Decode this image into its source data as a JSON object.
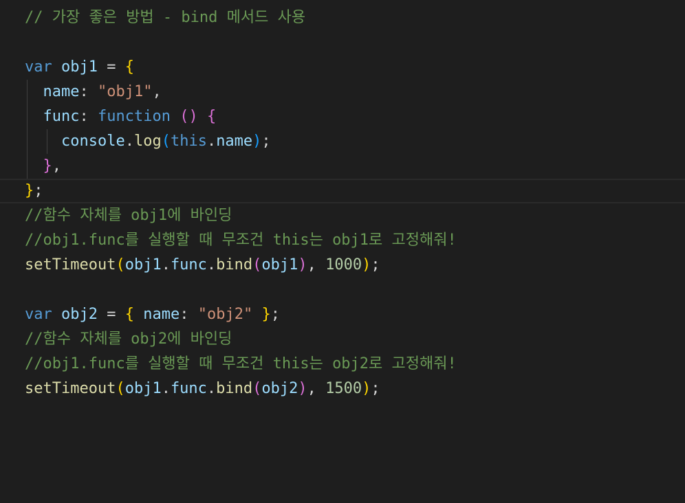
{
  "editor": {
    "lines": [
      {
        "tokens": [
          {
            "t": "// 가장 좋은 방법 - bind 메서드 사용",
            "c": "comment"
          }
        ]
      },
      {
        "tokens": []
      },
      {
        "tokens": [
          {
            "t": "var",
            "c": "keyword"
          },
          {
            "t": " ",
            "c": "punct"
          },
          {
            "t": "obj1",
            "c": "var"
          },
          {
            "t": " = ",
            "c": "punct"
          },
          {
            "t": "{",
            "c": "brace1"
          }
        ]
      },
      {
        "tokens": [
          {
            "t": "  ",
            "c": "punct"
          },
          {
            "t": "name",
            "c": "var"
          },
          {
            "t": ": ",
            "c": "punct"
          },
          {
            "t": "\"obj1\"",
            "c": "string"
          },
          {
            "t": ",",
            "c": "punct"
          }
        ]
      },
      {
        "tokens": [
          {
            "t": "  ",
            "c": "punct"
          },
          {
            "t": "func",
            "c": "var"
          },
          {
            "t": ": ",
            "c": "punct"
          },
          {
            "t": "function",
            "c": "keyword"
          },
          {
            "t": " ",
            "c": "punct"
          },
          {
            "t": "()",
            "c": "brace2"
          },
          {
            "t": " ",
            "c": "punct"
          },
          {
            "t": "{",
            "c": "brace2"
          }
        ]
      },
      {
        "tokens": [
          {
            "t": "    ",
            "c": "punct"
          },
          {
            "t": "console",
            "c": "var"
          },
          {
            "t": ".",
            "c": "punct"
          },
          {
            "t": "log",
            "c": "func"
          },
          {
            "t": "(",
            "c": "brace3"
          },
          {
            "t": "this",
            "c": "keyword"
          },
          {
            "t": ".",
            "c": "punct"
          },
          {
            "t": "name",
            "c": "var"
          },
          {
            "t": ")",
            "c": "brace3"
          },
          {
            "t": ";",
            "c": "punct"
          }
        ]
      },
      {
        "tokens": [
          {
            "t": "  ",
            "c": "punct"
          },
          {
            "t": "}",
            "c": "brace2"
          },
          {
            "t": ",",
            "c": "punct"
          }
        ]
      },
      {
        "tokens": [
          {
            "t": "}",
            "c": "brace1"
          },
          {
            "t": ";",
            "c": "punct"
          }
        ],
        "current": true
      },
      {
        "tokens": [
          {
            "t": "//함수 자체를 obj1에 바인딩",
            "c": "comment"
          }
        ]
      },
      {
        "tokens": [
          {
            "t": "//obj1.func를 실행할 때 무조건 this는 obj1로 고정해줘!",
            "c": "comment"
          }
        ]
      },
      {
        "tokens": [
          {
            "t": "setTimeout",
            "c": "func"
          },
          {
            "t": "(",
            "c": "brace1"
          },
          {
            "t": "obj1",
            "c": "var"
          },
          {
            "t": ".",
            "c": "punct"
          },
          {
            "t": "func",
            "c": "var"
          },
          {
            "t": ".",
            "c": "punct"
          },
          {
            "t": "bind",
            "c": "func"
          },
          {
            "t": "(",
            "c": "brace2"
          },
          {
            "t": "obj1",
            "c": "var"
          },
          {
            "t": ")",
            "c": "brace2"
          },
          {
            "t": ", ",
            "c": "punct"
          },
          {
            "t": "1000",
            "c": "number"
          },
          {
            "t": ")",
            "c": "brace1"
          },
          {
            "t": ";",
            "c": "punct"
          }
        ]
      },
      {
        "tokens": []
      },
      {
        "tokens": [
          {
            "t": "var",
            "c": "keyword"
          },
          {
            "t": " ",
            "c": "punct"
          },
          {
            "t": "obj2",
            "c": "var"
          },
          {
            "t": " = ",
            "c": "punct"
          },
          {
            "t": "{",
            "c": "brace1"
          },
          {
            "t": " ",
            "c": "punct"
          },
          {
            "t": "name",
            "c": "var"
          },
          {
            "t": ": ",
            "c": "punct"
          },
          {
            "t": "\"obj2\"",
            "c": "string"
          },
          {
            "t": " ",
            "c": "punct"
          },
          {
            "t": "}",
            "c": "brace1"
          },
          {
            "t": ";",
            "c": "punct"
          }
        ]
      },
      {
        "tokens": [
          {
            "t": "//함수 자체를 obj2에 바인딩",
            "c": "comment"
          }
        ]
      },
      {
        "tokens": [
          {
            "t": "//obj1.func를 실행할 때 무조건 this는 obj2로 고정해줘!",
            "c": "comment"
          }
        ]
      },
      {
        "tokens": [
          {
            "t": "setTimeout",
            "c": "func"
          },
          {
            "t": "(",
            "c": "brace1"
          },
          {
            "t": "obj1",
            "c": "var"
          },
          {
            "t": ".",
            "c": "punct"
          },
          {
            "t": "func",
            "c": "var"
          },
          {
            "t": ".",
            "c": "punct"
          },
          {
            "t": "bind",
            "c": "func"
          },
          {
            "t": "(",
            "c": "brace2"
          },
          {
            "t": "obj2",
            "c": "var"
          },
          {
            "t": ")",
            "c": "brace2"
          },
          {
            "t": ", ",
            "c": "punct"
          },
          {
            "t": "1500",
            "c": "number"
          },
          {
            "t": ")",
            "c": "brace1"
          },
          {
            "t": ";",
            "c": "punct"
          }
        ]
      }
    ]
  }
}
